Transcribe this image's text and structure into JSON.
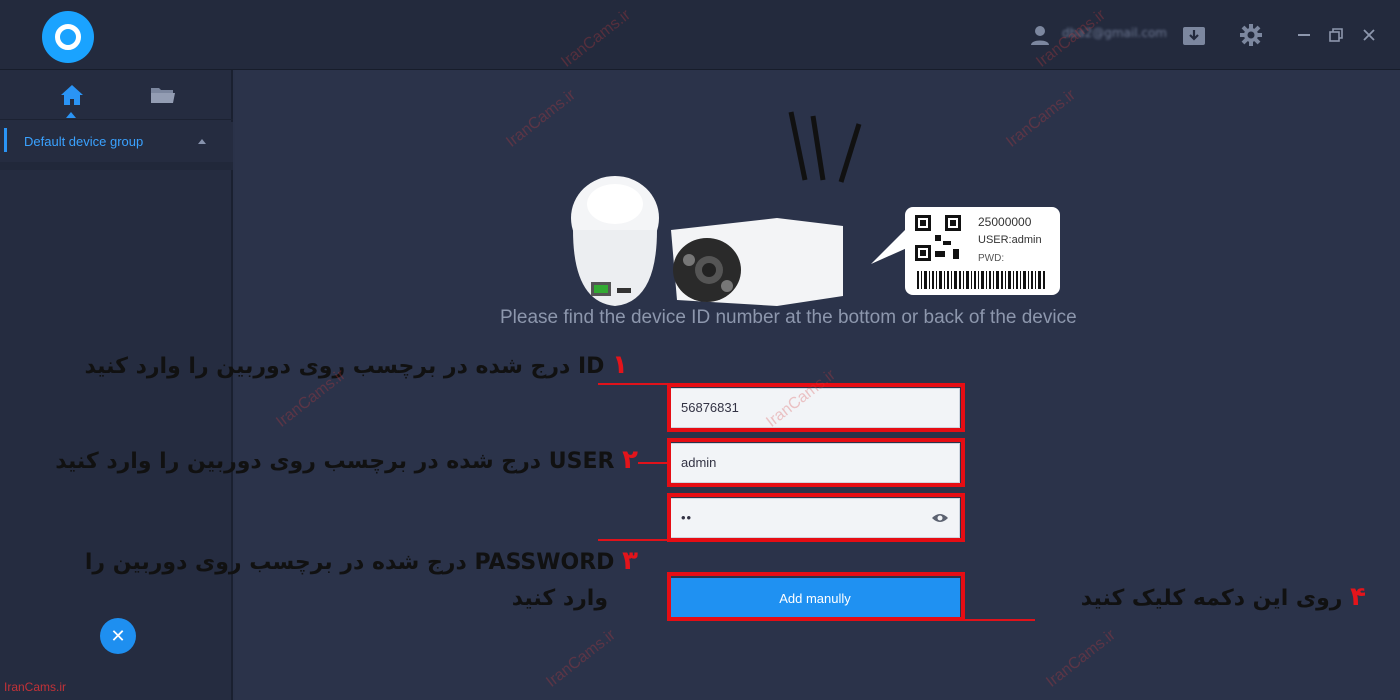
{
  "window": {
    "account_email": "dba2@gmail.com"
  },
  "sidebar": {
    "group_label": "Default device group"
  },
  "main": {
    "label_card": {
      "code": "25000000",
      "user": "USER:admin",
      "pwd": "PWD:"
    },
    "instruction": "Please find the device ID number at the bottom or back of the device",
    "device_id_value": "56876831",
    "user_value": "admin",
    "password_dots": "••",
    "add_button_label": "Add manully"
  },
  "annotations": {
    "step1_num": "۱",
    "step1_text": "ID درج شده در برچسب روی دوربین را وارد کنید",
    "step2_num": "۲",
    "step2_text": "USER درج شده در برچسب روی دوربین را وارد کنید",
    "step3_num": "۳",
    "step3_line1": "PASSWORD درج شده در برچسب روی دوربین را",
    "step3_line2": "وارد کنید",
    "step4_num": "۴",
    "step4_text": "روی این دکمه کلیک کنید"
  },
  "watermark_text": "IranCams.ir",
  "brand_text": "IranCams.ir",
  "colors": {
    "accent": "#1f91f2",
    "annotation_red": "#e60d14",
    "background": "#2b334a"
  }
}
